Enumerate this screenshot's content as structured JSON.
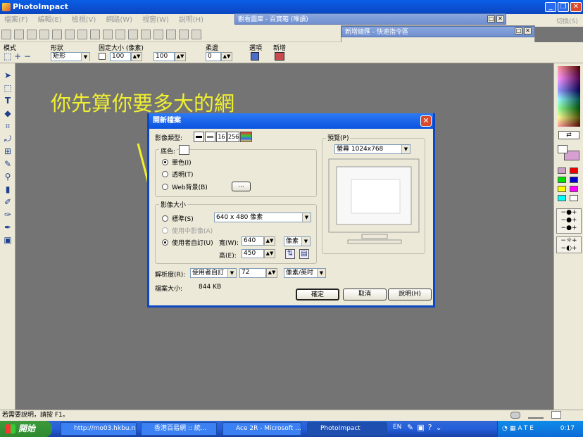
{
  "app": {
    "title": "PhotoImpact",
    "menu": [
      "檔案(F)",
      "編輯(E)",
      "檢視(V)",
      "網路(W)",
      "視窗(W)",
      "說明(H)"
    ],
    "switch_label": "切換(S)"
  },
  "floating": {
    "panel1": {
      "title": "觀看圖庫 - 百寶箱 (唯讀)"
    },
    "panel2": {
      "title": "新增總匯 - 快速指令區"
    }
  },
  "props": {
    "mode_label": "模式",
    "shape_label": "形狀",
    "shape_value": "矩形",
    "fixed_label": "固定大小 (像素)",
    "w_value": "100",
    "h_value": "100",
    "soft_label": "柔邊",
    "soft_value": "0",
    "option_label": "選項",
    "new_label": "新增"
  },
  "annotation": "你先算你要多大的網",
  "dialog": {
    "title": "開新檔案",
    "image_type_label": "影像類型:",
    "type_buttons": [
      "16",
      "256"
    ],
    "bg_label": "底色:",
    "bg_options": [
      "單色(I)",
      "透明(T)",
      "Web背景(B)"
    ],
    "browse": "...",
    "size_group": "影像大小",
    "standard_label": "標準(S)",
    "standard_value": "640 x 480 像素",
    "use_current": "使用中影像(A)",
    "custom_label": "使用者自訂(U)",
    "width_label": "寬(W):",
    "width_value": "640",
    "height_label": "高(E):",
    "height_value": "450",
    "unit_value": "像素",
    "preview_label": "預覽(P)",
    "preview_value": "螢幕 1024x768",
    "res_label": "解析度(R):",
    "res_mode": "使用者自訂",
    "res_value": "72",
    "res_unit": "像素/英吋",
    "filesize_label": "檔案大小:",
    "filesize_value": "844 KB",
    "ok": "確定",
    "cancel": "取消",
    "help": "說明(H)"
  },
  "status": {
    "text": "若需要說明，請按 F1。"
  },
  "taskbar": {
    "start": "開始",
    "tasks": [
      "http://mo03.hkbu.n...",
      "香港百易網 :: 統...",
      "Ace 2R - Microsoft ...",
      "PhotoImpact"
    ],
    "lang": "EN",
    "clock": "0:17"
  }
}
